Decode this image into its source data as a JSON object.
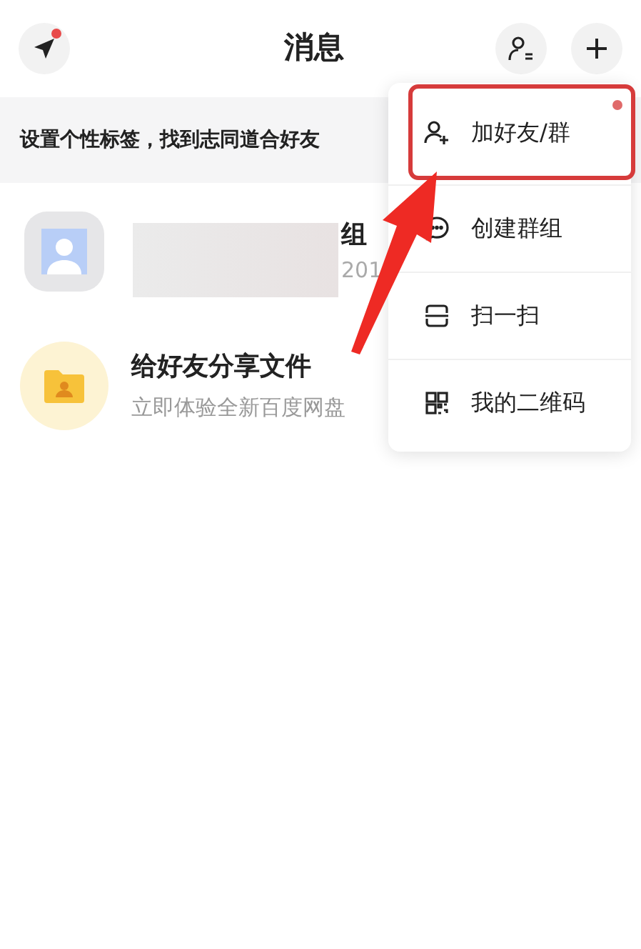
{
  "header": {
    "title": "消息",
    "send_badge": true
  },
  "banner": {
    "text": "设置个性标签，找到志同道合好友"
  },
  "chats": [
    {
      "kind": "redacted",
      "title_tail": "组",
      "subtitle_tail": "201"
    },
    {
      "kind": "folder",
      "title": "给好友分享文件",
      "subtitle": "立即体验全新百度网盘"
    }
  ],
  "menu": [
    {
      "kind": "add-friend",
      "label": "加好友/群",
      "highlighted": true,
      "badge": true
    },
    {
      "kind": "chat",
      "label": "创建群组",
      "highlighted": false,
      "badge": false
    },
    {
      "kind": "scan",
      "label": "扫一扫",
      "highlighted": false,
      "badge": false
    },
    {
      "kind": "qr",
      "label": "我的二维码",
      "highlighted": false,
      "badge": false
    }
  ],
  "annotation": {
    "arrow": true
  }
}
